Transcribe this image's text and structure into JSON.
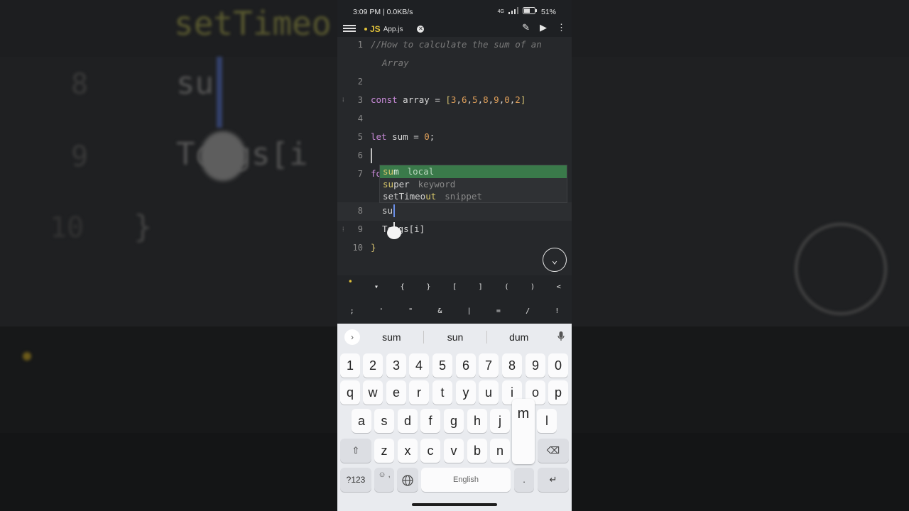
{
  "status": {
    "time": "3:09 PM | 0.0KB/s",
    "battery": "51%",
    "network": "4G"
  },
  "tab": {
    "lang": "JS",
    "file": "App.js"
  },
  "editor": {
    "lines": [
      {
        "n": "1",
        "text": "//How to calculate the sum of an",
        "cont": "Array"
      },
      {
        "n": "2",
        "text": ""
      },
      {
        "n": "3",
        "text": "const array = [3,6,5,8,9,0,2]"
      },
      {
        "n": "4",
        "text": ""
      },
      {
        "n": "5",
        "text": "let sum = 0;"
      },
      {
        "n": "6",
        "text": ""
      },
      {
        "n": "7",
        "text": "fo"
      },
      {
        "n": "8",
        "text": "su"
      },
      {
        "n": "9",
        "text": "Tongs[i]"
      },
      {
        "n": "10",
        "text": "}"
      }
    ],
    "autocomplete": [
      {
        "match": "su",
        "rest": "m",
        "type": "local"
      },
      {
        "match": "su",
        "rest": "per",
        "type": "keyword"
      },
      {
        "match": "setTimeo",
        "rest": "ut",
        "type": "snippet"
      }
    ]
  },
  "symbols": {
    "row1": [
      "•",
      "▾",
      "{",
      "}",
      "[",
      "]",
      "(",
      ")",
      "<"
    ],
    "row2": [
      ";",
      "'",
      "\"",
      "&",
      "|",
      "=",
      "/",
      "!"
    ]
  },
  "keyboard": {
    "suggestions": [
      "sum",
      "sun",
      "dum"
    ],
    "numbers": [
      "1",
      "2",
      "3",
      "4",
      "5",
      "6",
      "7",
      "8",
      "9",
      "0"
    ],
    "row1": [
      "q",
      "w",
      "e",
      "r",
      "t",
      "y",
      "u",
      "i",
      "o",
      "p"
    ],
    "row2": [
      "a",
      "s",
      "d",
      "f",
      "g",
      "h",
      "j",
      "l"
    ],
    "row3": [
      "z",
      "x",
      "c",
      "v",
      "b",
      "n"
    ],
    "popup": "m",
    "symbols_key": "?123",
    "emoji_key": "☺ ,",
    "space_label": "English",
    "period": "."
  },
  "background": {
    "big_code_top": "setTimeo",
    "big_ln_8": "8",
    "big_code_8": "su",
    "big_ln_9": "9",
    "big_code_9": "Tongs[i",
    "big_ln_10": "10",
    "big_code_10": "}"
  }
}
